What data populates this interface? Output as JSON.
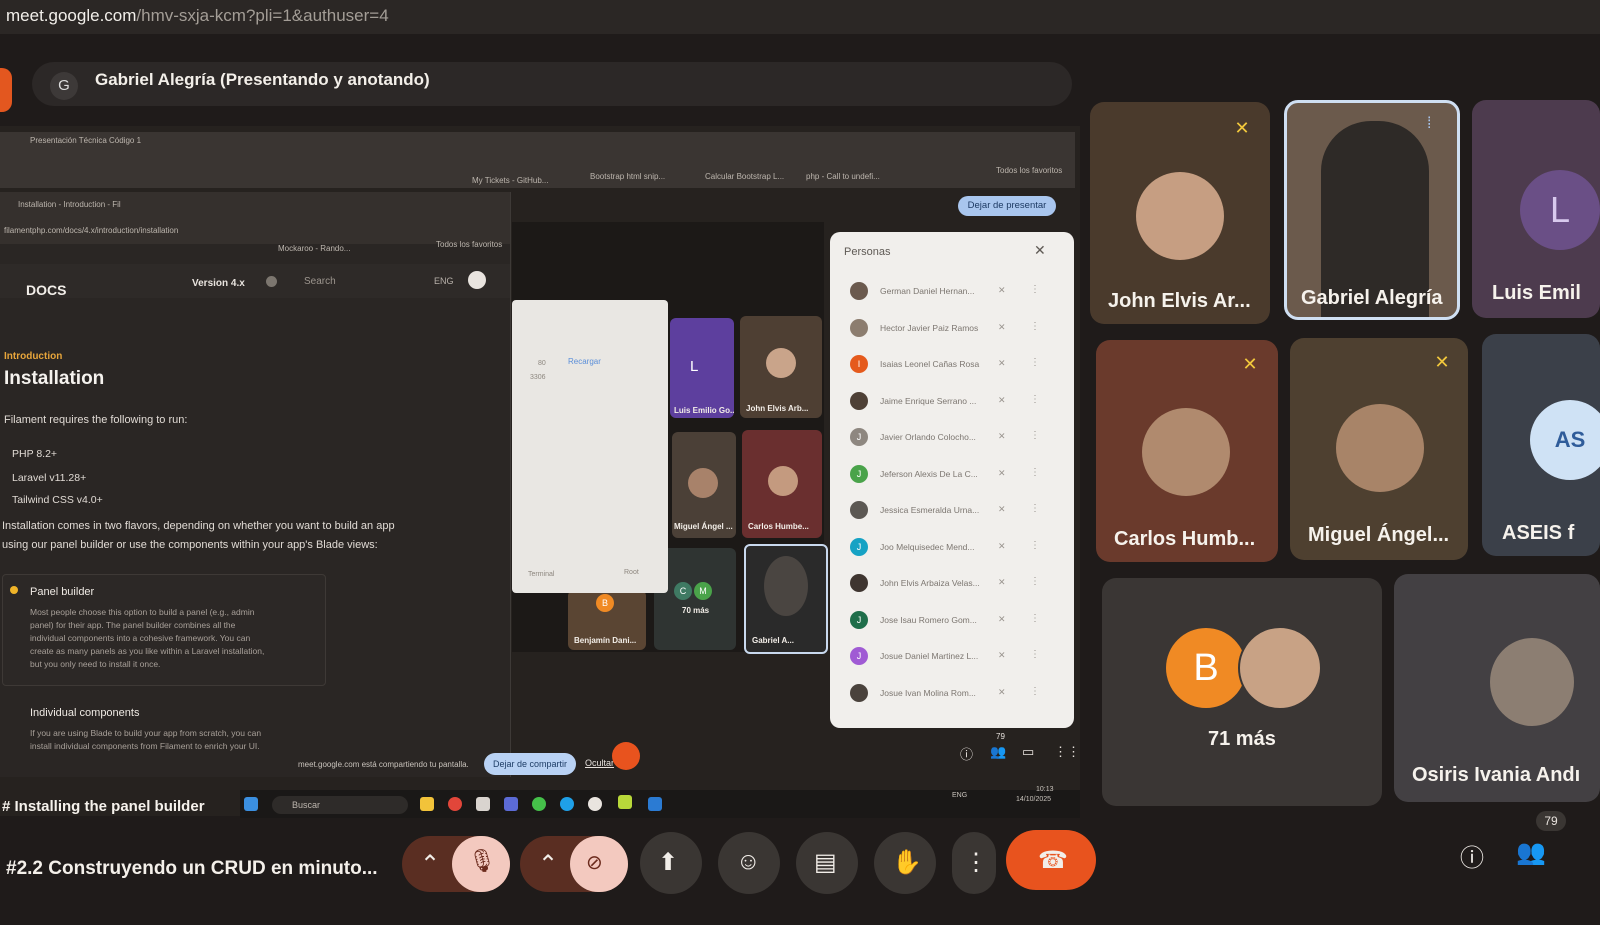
{
  "browser": {
    "url_host": "meet.google.com",
    "url_path": "/hmv-sxja-kcm?pli=1&authuser=4"
  },
  "banner": {
    "avatar_letter": "G",
    "text": "Gabriel Alegría (Presentando y anotando)"
  },
  "shared_screen": {
    "tabs": {
      "tab1": "Presentación Técnica Código 1",
      "tab2": "Installation - Introduction - Fil",
      "bookmark1": "Bootstrap html snip...",
      "bookmark2": "Calcular Bootstrap L...",
      "bookmark3": "php - Call to undefi...",
      "bookmark4": "Todos los favoritos",
      "bookmark5": "My Tickets - GitHub...",
      "bookmark6": "Mockaroo - Rando..."
    },
    "docs": {
      "url": "filamentphp.com/docs/4.x/introduction/installation",
      "logo_text": "DOCS",
      "version": "Version 4.x",
      "search": "Search",
      "lang": "ENG",
      "section": "Introduction",
      "title": "Installation",
      "intro": "Filament requires the following to run:",
      "requirements": [
        "PHP 8.2+",
        "Laravel v11.28+",
        "Tailwind CSS v4.0+"
      ],
      "flavors_1": "Installation comes in two flavors, depending on whether you want to build an app",
      "flavors_2": "using our panel builder or use the components within your app's Blade views:",
      "card1_title": "Panel builder",
      "card1_lines": [
        "Most people choose this option to build a panel (e.g., admin",
        "panel) for their app. The panel builder combines all the",
        "individual components into a cohesive framework. You can",
        "create as many panels as you like within a Laravel installation,",
        "but you only need to install it once."
      ],
      "card2_title": "Individual components",
      "card2_lines": [
        "If you are using Blade to build your app from scratch, you can",
        "install individual components from Filament to enrich your UI."
      ],
      "heading2": "# Installing the panel builder"
    },
    "inner_meet": {
      "stop_presenting": "Dejar de presentar",
      "popup_reload": "Recargar",
      "popup_port1": "80",
      "popup_port2": "3306",
      "popup_terminal": "Terminal",
      "popup_root": "Root",
      "tiles": {
        "t1": "Luis Emilio Go...",
        "t2": "John Elvis Arb...",
        "t3": "Miguel Ángel ...",
        "t4": "Carlos Humbe...",
        "t5": "Benjamín Dani...",
        "t6": "70 más",
        "t7": "Gabriel A...",
        "t1_letter": "L",
        "t5_letter": "B",
        "t6_letters": [
          "C",
          "M"
        ]
      },
      "people_title": "Personas",
      "people": [
        {
          "name": "German Daniel Hernan...",
          "letter": "",
          "color": "#6b5a4e"
        },
        {
          "name": "Hector Javier Paiz Ramos",
          "letter": "",
          "color": "#8c7d6f"
        },
        {
          "name": "Isaias Leonel Cañas Rosa",
          "letter": "I",
          "color": "#e55a1c"
        },
        {
          "name": "Jaime Enrique Serrano ...",
          "letter": "",
          "color": "#4e4036"
        },
        {
          "name": "Javier Orlando Colocho...",
          "letter": "J",
          "color": "#8e8780"
        },
        {
          "name": "Jeferson Alexis De La C...",
          "letter": "J",
          "color": "#4aa34a"
        },
        {
          "name": "Jessica Esmeralda Urna...",
          "letter": "",
          "color": "#5c5853"
        },
        {
          "name": "Joo Melquisedec Mend...",
          "letter": "J",
          "color": "#16a2c4"
        },
        {
          "name": "John Elvis Arbaiza Velas...",
          "letter": "",
          "color": "#3f3530"
        },
        {
          "name": "Jose Isau Romero Gom...",
          "letter": "J",
          "color": "#1f6e4a"
        },
        {
          "name": "Josue Daniel Martinez L...",
          "letter": "J",
          "color": "#a05bd4"
        },
        {
          "name": "Josue Ivan Molina Rom...",
          "letter": "",
          "color": "#4a423c"
        }
      ],
      "people_count": "79",
      "share_message": "meet.google.com está compartiendo tu pantalla.",
      "stop_sharing": "Dejar de compartir",
      "hide": "Ocultar",
      "taskbar_search": "Buscar",
      "clock_time": "10:13",
      "clock_date": "14/10/2025",
      "lang_indicator": "ENG"
    }
  },
  "participants": {
    "p1": "John Elvis Ar...",
    "p2": "Gabriel Alegría",
    "p3": "Luis Emil",
    "p3_letter": "L",
    "p4": "Carlos Humb...",
    "p5": "Miguel Ángel...",
    "p6": "ASEIS f",
    "p6_logo": "AS",
    "p7": "71 más",
    "p7_letter": "B",
    "p8": "Osiris Ivania Andı"
  },
  "bottom": {
    "meeting_title": "#2.2 Construyendo un CRUD en minuto...",
    "people_badge": "79"
  },
  "colors": {
    "end_call": "#e8531e",
    "mic_off": "#f3c9bf",
    "accent_blue": "#a9c6ee"
  }
}
